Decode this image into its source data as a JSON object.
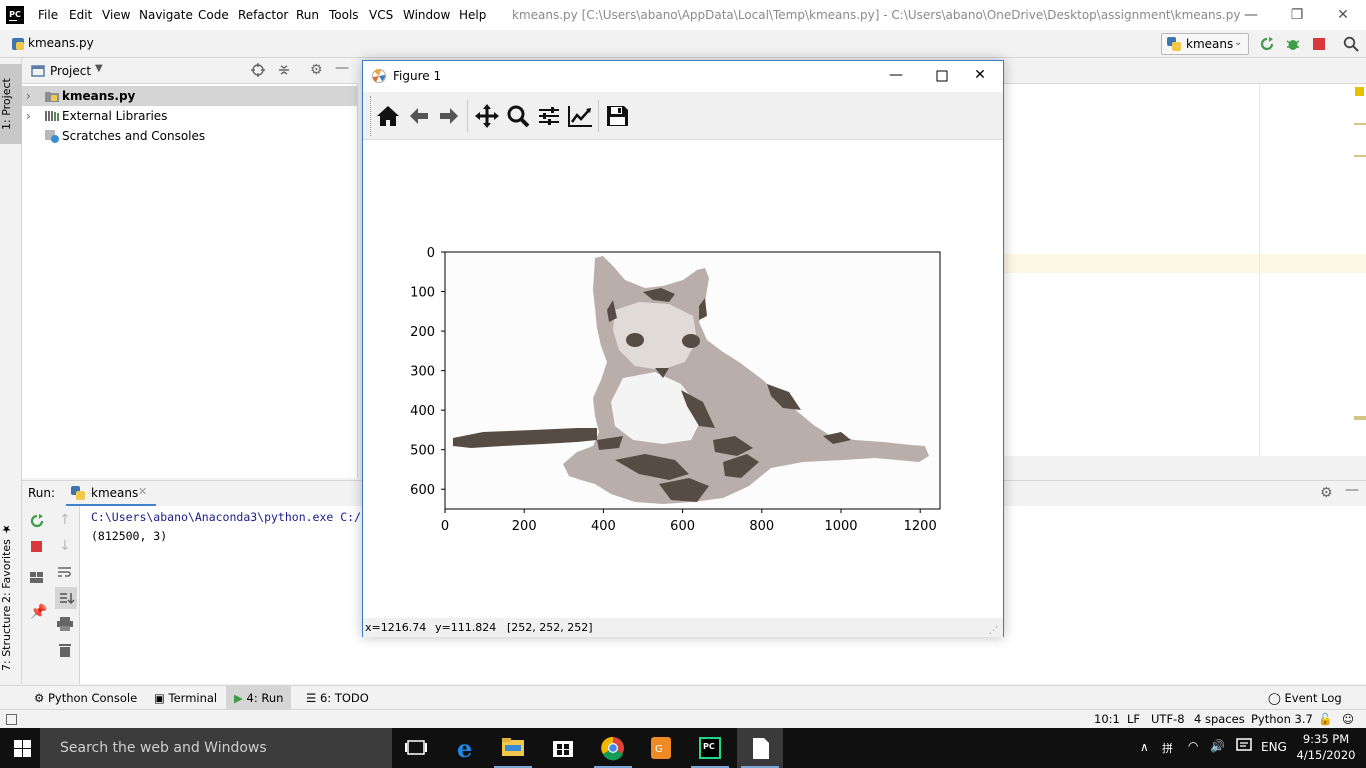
{
  "titlebar": {
    "logo": "PC",
    "menu": [
      "File",
      "Edit",
      "View",
      "Navigate",
      "Code",
      "Refactor",
      "Run",
      "Tools",
      "VCS",
      "Window",
      "Help"
    ],
    "window_title": "kmeans.py [C:\\Users\\abano\\AppData\\Local\\Temp\\kmeans.py] - C:\\Users\\abano\\OneDrive\\Desktop\\assignment\\kmeans.py"
  },
  "navbar": {
    "file": "kmeans.py",
    "run_config": "kmeans"
  },
  "left_stripe": {
    "project": "1: Project",
    "favorites": "2: Favorites",
    "structure": "7: Structure"
  },
  "project_panel": {
    "title": "Project",
    "tree": [
      {
        "label": "kmeans.py",
        "icon": "python-file-icon",
        "selected": true
      },
      {
        "label": "External Libraries",
        "icon": "libraries-icon"
      },
      {
        "label": "Scratches and Consoles",
        "icon": "scratches-icon"
      }
    ]
  },
  "run_panel": {
    "label": "Run:",
    "tab": "kmeans",
    "console": [
      "C:\\Users\\abano\\Anaconda3\\python.exe C:/",
      "(812500, 3)"
    ]
  },
  "bottom_tabs": [
    "Python Console",
    "Terminal",
    "4: Run",
    "6: TODO"
  ],
  "event_log": "Event Log",
  "statusbar": {
    "position": "10:1",
    "line_sep": "LF",
    "encoding": "UTF-8",
    "indent": "4 spaces",
    "interpreter": "Python 3.7"
  },
  "taskbar": {
    "search": "Search the web and Windows",
    "lang": "ENG",
    "time": "9:35 PM",
    "date": "4/15/2020"
  },
  "figure": {
    "title": "Figure 1",
    "status": {
      "x": "x=1216.74",
      "y": "y=111.824",
      "rgb": "[252, 252, 252]"
    },
    "chart_data": {
      "type": "image",
      "xticks": [
        "0",
        "200",
        "400",
        "600",
        "800",
        "1000",
        "1200"
      ],
      "yticks": [
        "0",
        "100",
        "200",
        "300",
        "400",
        "500",
        "600"
      ],
      "xlim": [
        0,
        1250
      ],
      "ylim": [
        650,
        0
      ],
      "colors": [
        "#fcfcfc",
        "#b9aeaa",
        "#574c44"
      ]
    }
  }
}
